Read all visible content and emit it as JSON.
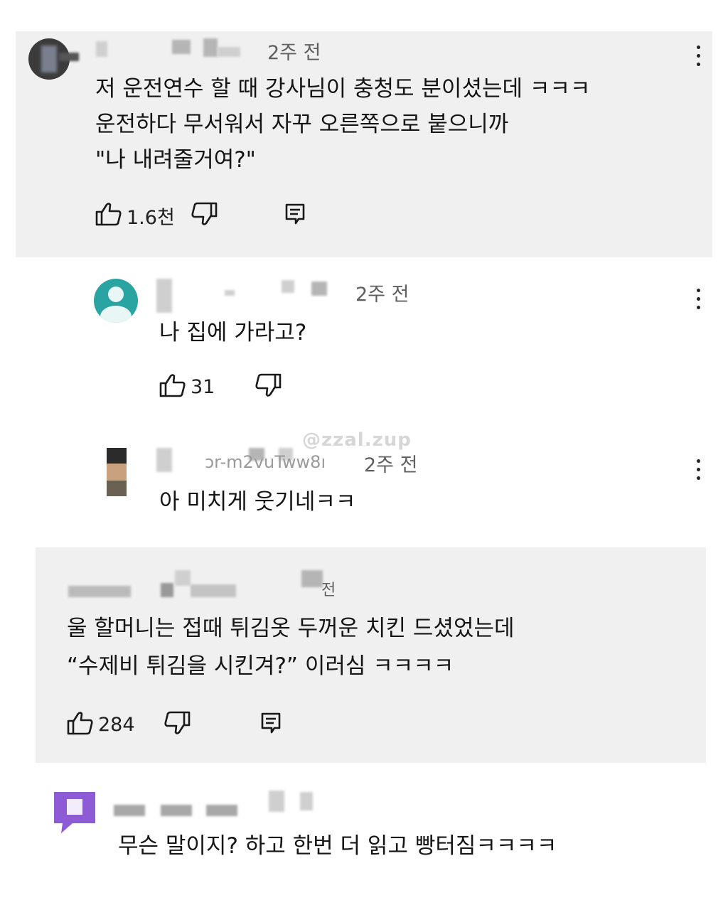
{
  "comments": [
    {
      "time": "2주 전",
      "lines": [
        "저 운전연수 할 때 강사님이 충청도 분이셨는데 ㅋㅋㅋ",
        "운전하다 무서워서 자꾸 오른쪽으로 붙으니까",
        "\"나 내려줄거여?\""
      ],
      "likes": "1.6천"
    },
    {
      "time": "2주 전",
      "lines": [
        "나 집에 가라고?"
      ],
      "likes": "31"
    },
    {
      "handle_fragment": "ɔr-m2vuTww8ı",
      "time": "2주 전",
      "lines": [
        "아 미치게 웃기네ㅋㅋ"
      ]
    },
    {
      "time_fragment": "전",
      "lines": [
        "울 할머니는 접때 튀김옷 두꺼운 치킨 드셨었는데",
        "“수제비 튀김을 시킨겨?” 이러심 ㅋㅋㅋㅋ"
      ],
      "likes": "284"
    },
    {
      "lines": [
        "무슨 말이지? 하고 한번 더 읽고 빵터짐ㅋㅋㅋㅋ"
      ]
    }
  ],
  "watermark": "@zzal.zup",
  "icons": {
    "like": "thumbs-up-icon",
    "dislike": "thumbs-down-icon",
    "reply": "reply-icon",
    "more": "more-vert-icon"
  },
  "colors": {
    "card_bg": "#f0f0f0",
    "meta_text": "#606060",
    "avatar_teal": "#2aa3a3",
    "avatar_purple": "#8e5bd6"
  }
}
